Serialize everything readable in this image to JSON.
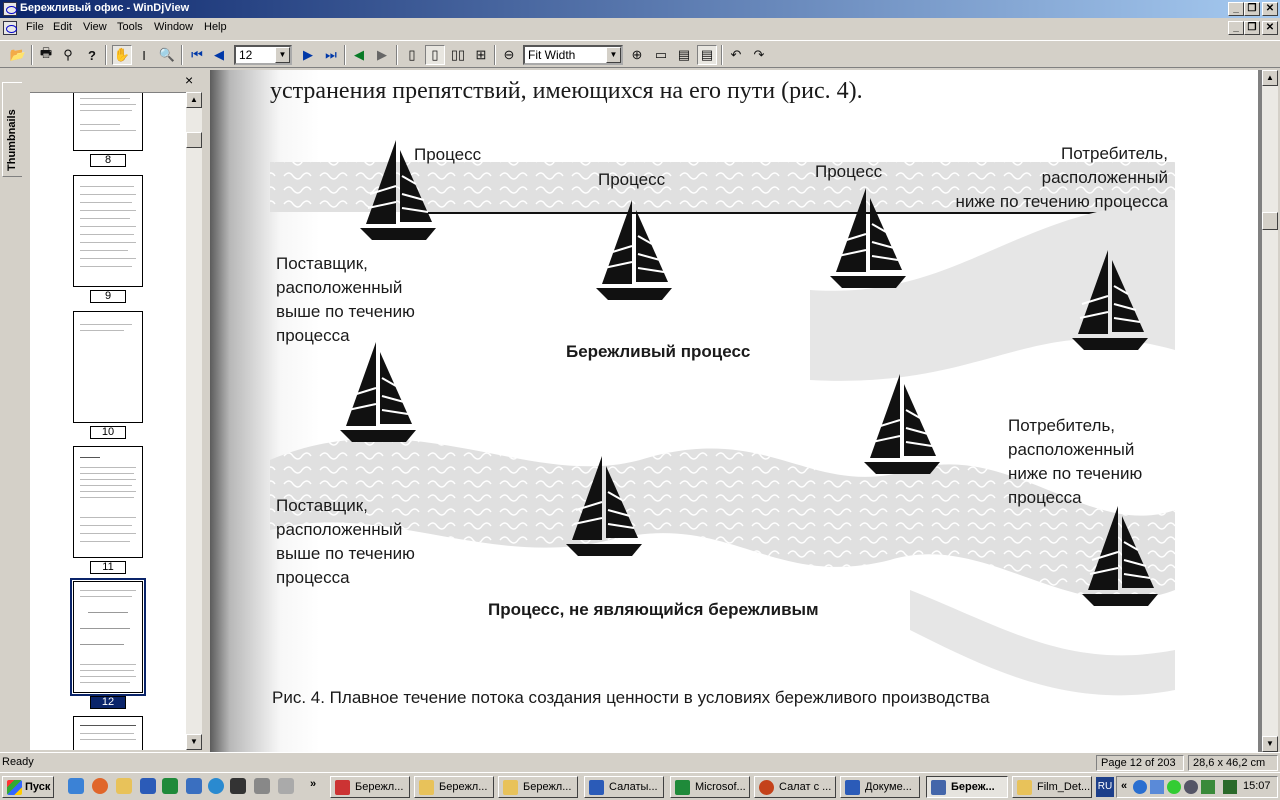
{
  "window": {
    "title": "Бережливый офис - WinDjView",
    "minimize": "_",
    "restore": "❐",
    "close": "✕"
  },
  "menu": [
    "File",
    "Edit",
    "View",
    "Tools",
    "Window",
    "Help"
  ],
  "toolbar": {
    "page_input": "12",
    "zoom": "Fit Width"
  },
  "sidebar": {
    "tab_label": "Thumbnails",
    "close": "×",
    "thumbnails": [
      "8",
      "9",
      "10",
      "11",
      "12"
    ],
    "selected": "12"
  },
  "document": {
    "top_line": "устранения препятствий, имеющихся на его пути (рис. 4).",
    "lean": {
      "process_1": "Процесс",
      "process_2": "Процесс",
      "process_3": "Процесс",
      "consumer": [
        "Потребитель,",
        "расположенный",
        "ниже по течению процесса"
      ],
      "supplier": [
        "Поставщик,",
        "расположенный",
        "выше по течению",
        "процесса"
      ],
      "title": "Бережливый процесс"
    },
    "nonlean": {
      "supplier": [
        "Поставщик,",
        "расположенный",
        "выше по течению",
        "процесса"
      ],
      "consumer": [
        "Потребитель,",
        "расположенный",
        "ниже по течению",
        "процесса"
      ],
      "title": "Процесс, не являющийся бережливым"
    },
    "caption": "Рис. 4. Плавное течение потока создания ценности в условиях бережливого производства"
  },
  "status": {
    "text": "Ready",
    "page": "Page 12 of 203",
    "size": "28,6 x 46,2 cm"
  },
  "taskbar": {
    "start": "Пуск",
    "more": "»",
    "tasks": [
      "Бережл...",
      "Бережл...",
      "Бережл...",
      "Салаты...",
      "Microsof...",
      "Салат с ...",
      "Докуме...",
      "Береж...",
      "Film_Det..."
    ],
    "active_index": 7,
    "clock": "15:07",
    "lang": "RU"
  }
}
